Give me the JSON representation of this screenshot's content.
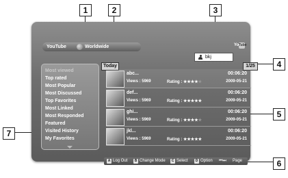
{
  "callouts": [
    "1",
    "2",
    "3",
    "4",
    "5",
    "6",
    "7"
  ],
  "header": {
    "service": "YouTube",
    "region": "Worldwide",
    "logo_you": "You",
    "logo_tube": "Tube"
  },
  "user": {
    "name": "bkj"
  },
  "list_header": {
    "today": "Today",
    "page": "1/25"
  },
  "menu": {
    "items": [
      "Most viewed",
      "Top rated",
      "Most Popular",
      "Most Discussed",
      "Top Favorites",
      "Most Linked",
      "Most Responded",
      "Featured",
      "Visited History",
      "My Favorites"
    ]
  },
  "videos": [
    {
      "title": "abc...",
      "duration": "00:06:20",
      "views": "Views : 5969",
      "rating_label": "Rating :",
      "stars": 4,
      "date": "2009-05-21"
    },
    {
      "title": "def...",
      "duration": "00:06:20",
      "views": "Views : 5969",
      "rating_label": "Rating :",
      "stars": 5,
      "date": "2009-05-21"
    },
    {
      "title": "ghi...",
      "duration": "00:06:20",
      "views": "Views : 5969",
      "rating_label": "Rating :",
      "stars": 4,
      "date": "2009-05-21"
    },
    {
      "title": "jkl...",
      "duration": "00:06:20",
      "views": "Views : 5969",
      "rating_label": "Rating :",
      "stars": 5,
      "date": "2009-05-21"
    }
  ],
  "footer": {
    "logout_key": "A",
    "logout": "Log Out",
    "change_key": "B",
    "change": "Change Mode",
    "select_key": "C",
    "select": "Select",
    "option_key": "D",
    "option": "Option",
    "page_key": "⏮⏭",
    "page": "Page"
  }
}
